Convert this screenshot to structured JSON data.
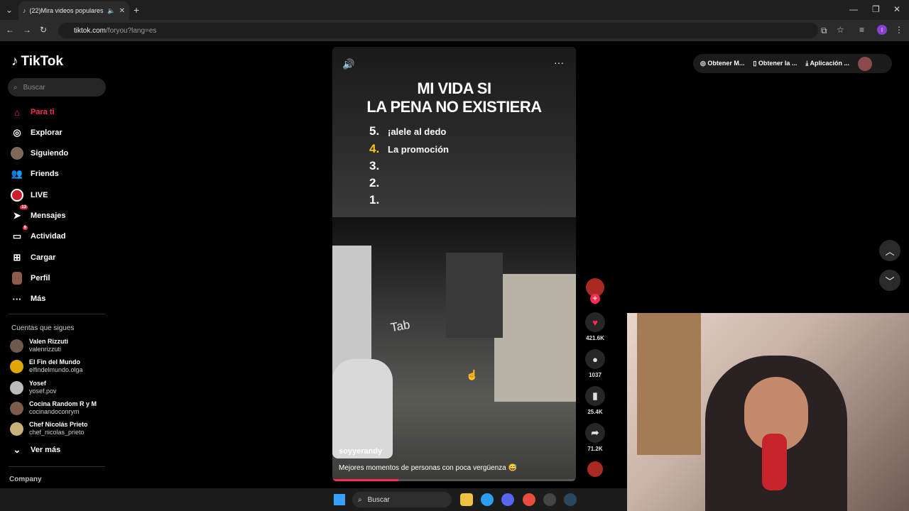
{
  "browser": {
    "tab_title": "(22)Mira videos populares s",
    "url_host": "tiktok.com",
    "url_path": "/foryou?lang=es",
    "new_tab": "+",
    "profile_letter": "I"
  },
  "sidebar": {
    "logo": "TikTok",
    "search_placeholder": "Buscar",
    "nav": [
      {
        "label": "Para ti",
        "icon": "home-icon",
        "active": true
      },
      {
        "label": "Explorar",
        "icon": "compass-icon"
      },
      {
        "label": "Siguiendo",
        "icon": "following-avatar-icon"
      },
      {
        "label": "Friends",
        "icon": "friends-icon"
      },
      {
        "label": "LIVE",
        "icon": "live-icon"
      },
      {
        "label": "Mensajes",
        "icon": "messages-icon",
        "badge": "13"
      },
      {
        "label": "Actividad",
        "icon": "activity-icon",
        "badge": "9"
      },
      {
        "label": "Cargar",
        "icon": "upload-icon"
      },
      {
        "label": "Perfil",
        "icon": "profile-icon"
      },
      {
        "label": "Más",
        "icon": "more-icon"
      }
    ],
    "following_title": "Cuentas que sigues",
    "following": [
      {
        "name": "Valen Rizzuti",
        "handle": "valenrizzuti"
      },
      {
        "name": "El Fin del Mundo",
        "handle": "elfindelmundo.olga"
      },
      {
        "name": "Yosef",
        "handle": "yosef.pov"
      },
      {
        "name": "Cocina Random R y M",
        "handle": "cocinandoconrym"
      },
      {
        "name": "Chef Nicolás Prieto",
        "handle": "chef_nicolas_prieto"
      }
    ],
    "see_more": "Ver más",
    "company": "Company"
  },
  "video": {
    "title_line1": "MI VIDA SI",
    "title_line2": "LA PENA NO EXISTIERA",
    "ranks": [
      {
        "n": "5.",
        "text": "¡alele al dedo"
      },
      {
        "n": "4.",
        "text": "La promoción"
      },
      {
        "n": "3.",
        "text": ""
      },
      {
        "n": "2.",
        "text": ""
      },
      {
        "n": "1.",
        "text": ""
      }
    ],
    "overlay_text": "Tab",
    "author": "soyyerandy",
    "description": "Mejores momentos de personas con poca vergüenza 😅",
    "progress": 0.27
  },
  "actions": {
    "likes": "421.6K",
    "comments": "1037",
    "saves": "25.4K",
    "shares": "71.2K"
  },
  "topbar": {
    "get_coins": "Obtener M...",
    "get_app": "Obtener la ...",
    "app": "Aplicación ..."
  },
  "taskbar": {
    "search": "Buscar"
  },
  "colors": {
    "accent": "#fe2c55",
    "background": "#000000"
  }
}
